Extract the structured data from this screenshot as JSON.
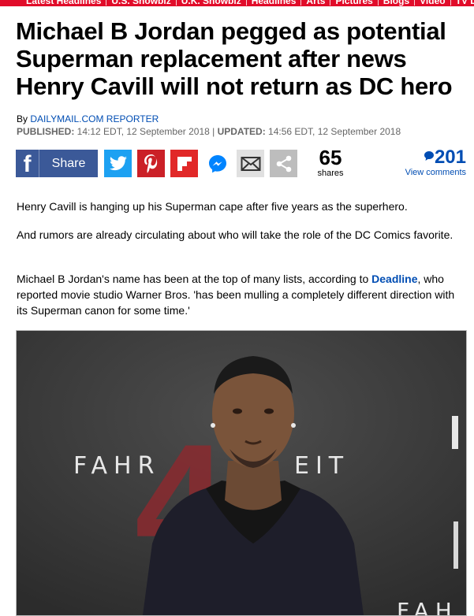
{
  "nav": {
    "items": [
      "Latest Headlines",
      "U.S. Showbiz",
      "U.K. Showbiz",
      "Headlines",
      "Arts",
      "Pictures",
      "Blogs",
      "Video",
      "TV Lis"
    ]
  },
  "article": {
    "headline": "Michael B Jordan pegged as potential Superman replacement after news Henry Cavill will not return as DC hero",
    "byline_prefix": "By ",
    "author": "DAILYMAIL.COM REPORTER",
    "published_label": "PUBLISHED:",
    "published_value": " 14:12 EDT, 12 September 2018 | ",
    "updated_label": "UPDATED:",
    "updated_value": " 14:56 EDT, 12 September 2018",
    "p1": "Henry Cavill is hanging up his Superman cape after five years as the superhero.",
    "p2": "And rumors are already circulating about who will take the role of the DC Comics favorite.",
    "p3_before": "Michael B Jordan's name has been at the top of many lists, according to ",
    "p3_link": "Deadline",
    "p3_after": ", who reported movie studio Warner Bros. 'has been mulling a completely different direction with its Superman canon for some time.'"
  },
  "share": {
    "facebook_label": "Share",
    "count": "65",
    "count_label": "shares",
    "comments_count": "201",
    "comments_label": "View comments"
  },
  "photo": {
    "backdrop_text_left": "FAHR",
    "backdrop_text_right": "EIT",
    "backdrop_number": "4",
    "backdrop_text_bottom": "FAH"
  },
  "colors": {
    "brand_red": "#e10c2a",
    "link_blue": "#004db3",
    "facebook": "#3b5998",
    "twitter": "#1da1f2",
    "pinterest": "#cb2027",
    "flipboard": "#e12828"
  }
}
